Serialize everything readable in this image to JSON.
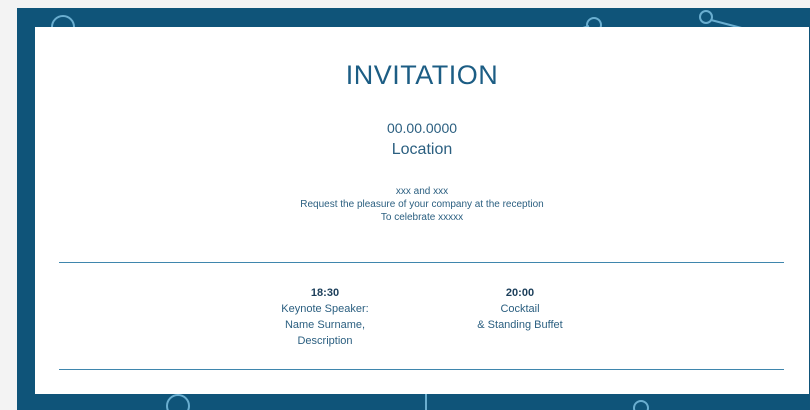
{
  "colors": {
    "frame": "#0f5479",
    "card": "#ffffff",
    "text": "#2b5f80",
    "rule": "#3f86ad"
  },
  "invitation": {
    "title": "INVITATION",
    "date": "00.00.0000",
    "location": "Location",
    "lines": [
      "xxx and xxx",
      "Request the pleasure of your company at the reception",
      "To celebrate xxxxx"
    ]
  },
  "schedule": [
    {
      "time": "18:30",
      "lines": [
        "Keynote Speaker:",
        "Name Surname,",
        "Description"
      ]
    },
    {
      "time": "20:00",
      "lines": [
        "Cocktail",
        "& Standing Buffet"
      ]
    }
  ]
}
